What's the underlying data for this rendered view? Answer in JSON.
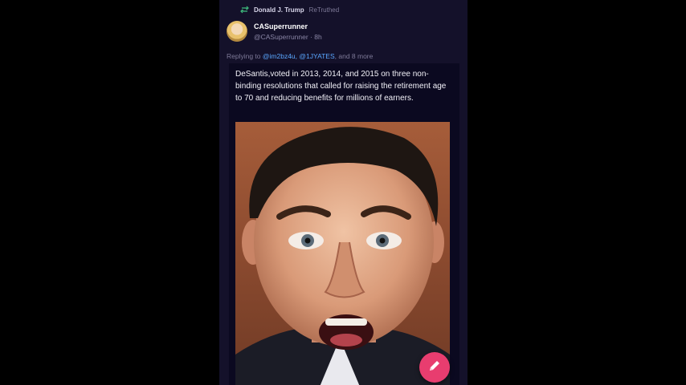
{
  "retruth": {
    "icon": "retruth-icon",
    "user": "Donald J. Trump",
    "suffix": "ReTruthed"
  },
  "author": {
    "display_name": "CASuperrunner",
    "handle": "@CASuperrunner",
    "separator": "·",
    "time": "8h"
  },
  "reply": {
    "prefix": "Replying to",
    "mentions": [
      "@im2bz4u",
      "@1JYATES"
    ],
    "mention_sep": ",",
    "suffix": ", and 8 more"
  },
  "post": {
    "text": "DeSantis,voted in 2013, 2014, and 2015 on three non-binding resolutions that called for raising the retirement age to 70 and reducing benefits for millions of earners."
  },
  "fab": {
    "icon": "pencil-icon",
    "color": "#e83d6f"
  },
  "colors": {
    "mention": "#5aa7ff",
    "background": "#14112a"
  }
}
